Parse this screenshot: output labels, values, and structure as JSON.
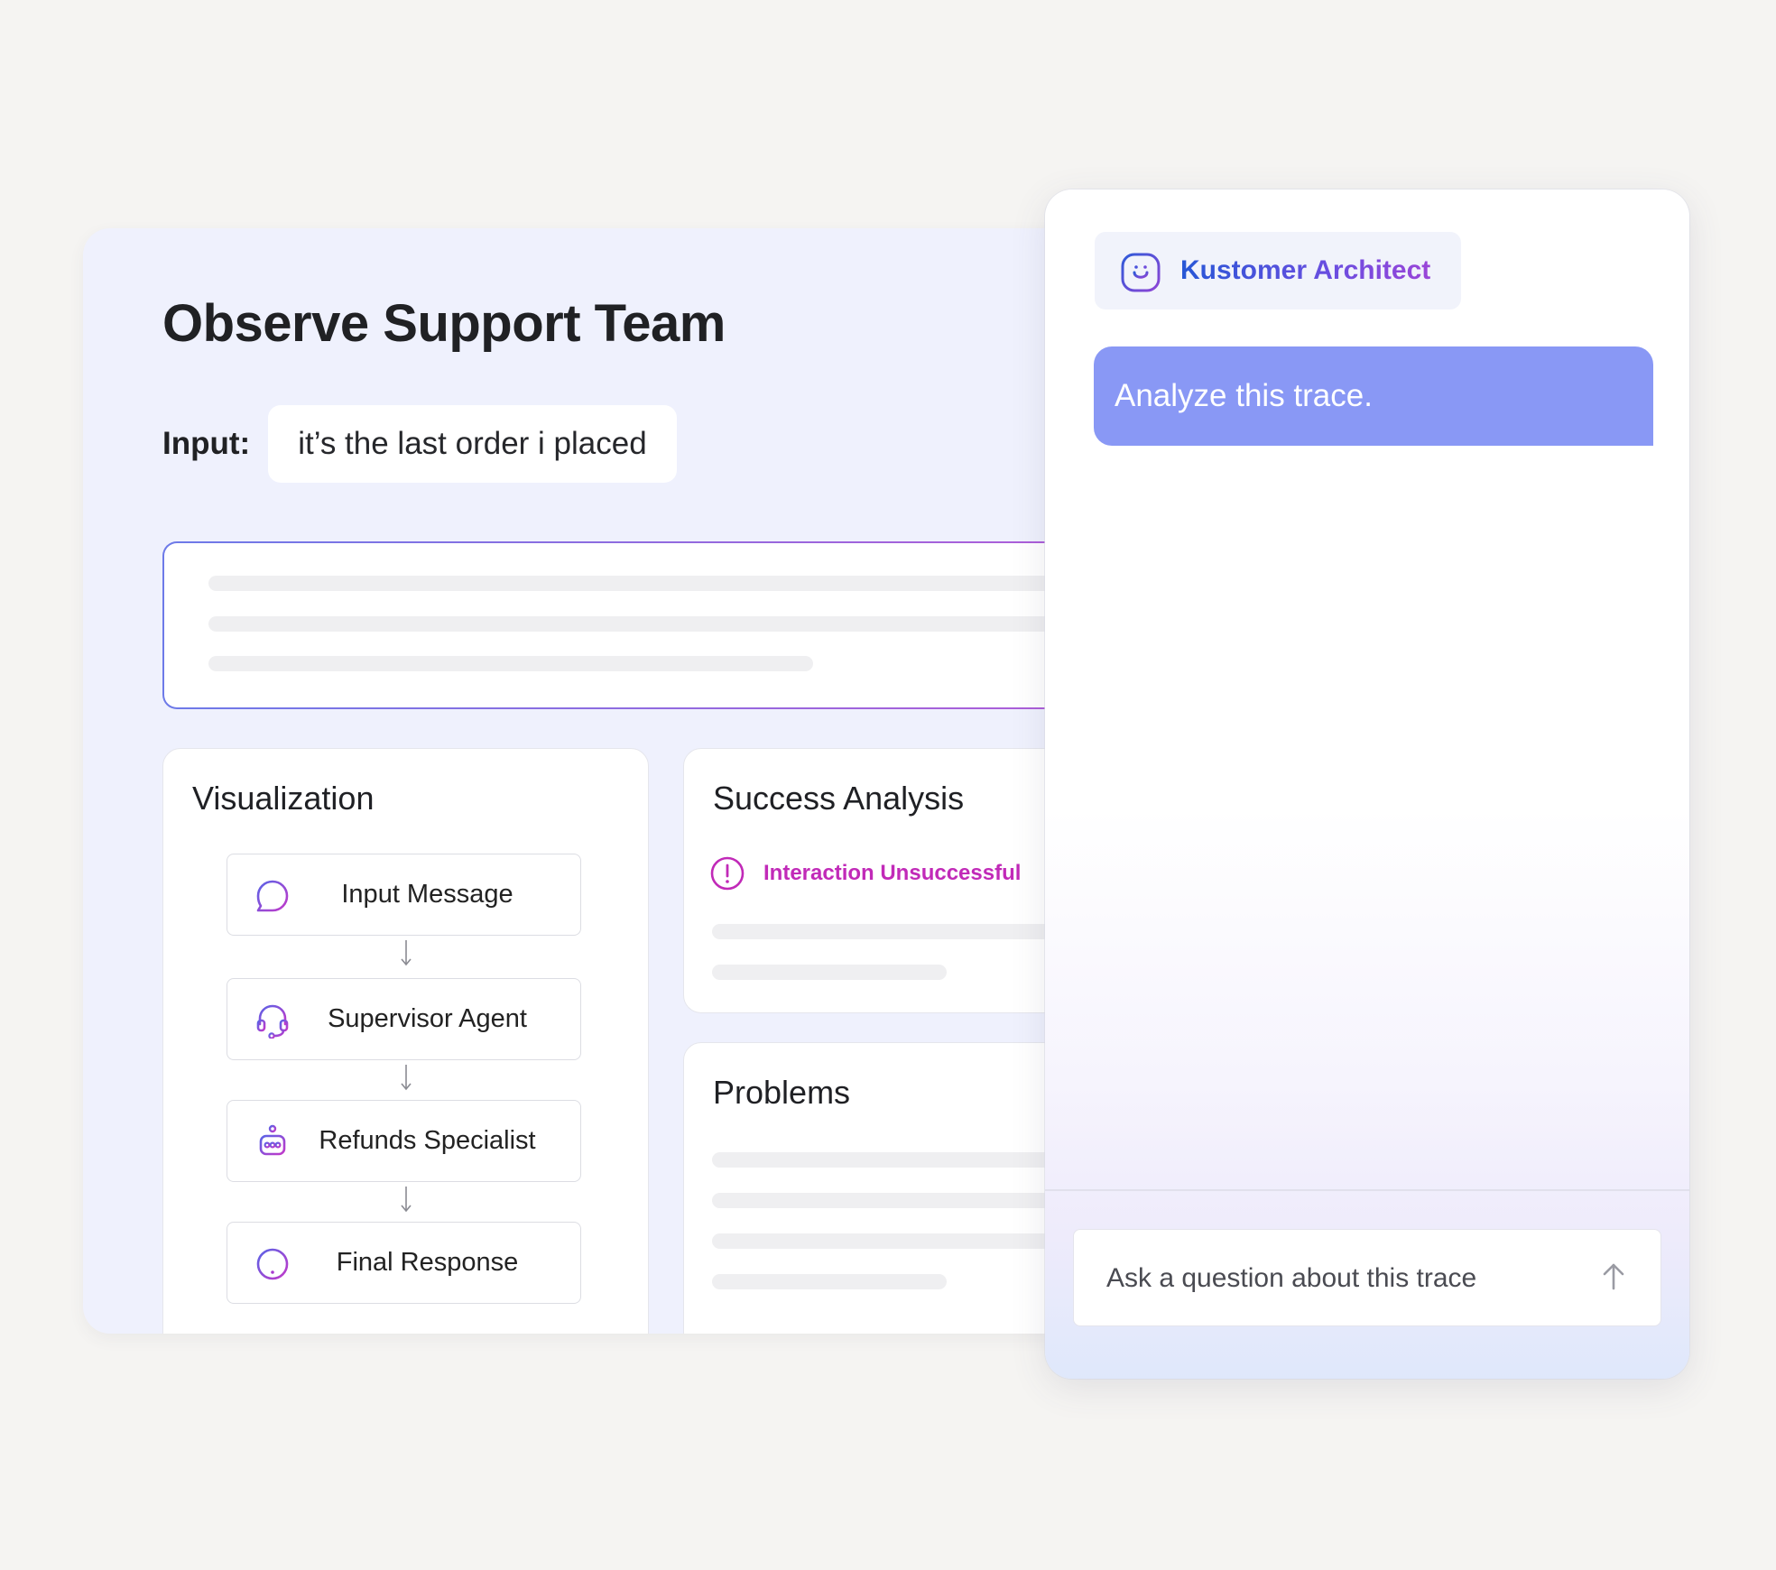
{
  "main": {
    "title": "Observe Support Team",
    "input_label": "Input:",
    "input_value": "it’s the last order i placed"
  },
  "visualization": {
    "title": "Visualization",
    "nodes": [
      {
        "label": "Input Message",
        "icon": "chat-bubble-icon"
      },
      {
        "label": "Supervisor Agent",
        "icon": "headset-icon"
      },
      {
        "label": "Refunds Specialist",
        "icon": "robot-icon"
      },
      {
        "label": "Final Response",
        "icon": "alert-circle-icon"
      }
    ]
  },
  "success_analysis": {
    "title": "Success Analysis",
    "status": "Interaction Unsuccessful",
    "status_icon": "alert-circle-icon",
    "status_color": "#c12ab8"
  },
  "problems": {
    "title": "Problems"
  },
  "chat": {
    "brand_name": "Kustomer Architect",
    "brand_icon": "smiley-face-icon",
    "user_message": "Analyze this trace.",
    "ask_placeholder": "Ask a question about this trace",
    "send_icon": "arrow-up-icon",
    "bubble_color": "#8998f5"
  },
  "colors": {
    "background": "#f5f4f2",
    "panel": "#eff1fd",
    "accent_blue": "#2757d6",
    "accent_purple": "#9a45d8"
  }
}
